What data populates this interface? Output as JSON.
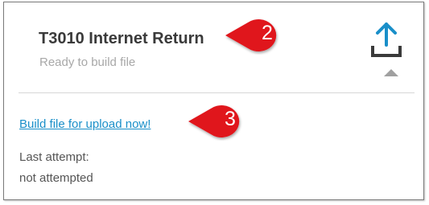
{
  "card": {
    "title": "T3010 Internet Return",
    "status": "Ready to build file",
    "upload_icon": "upload-icon",
    "collapse_icon": "chevron-up-icon",
    "build_link": "Build file for upload now!",
    "last_attempt_label": "Last attempt:",
    "last_attempt_value": "not attempted"
  },
  "callouts": [
    {
      "number": "2"
    },
    {
      "number": "3"
    }
  ],
  "colors": {
    "accent": "#1a8fc9",
    "callout": "#e0161d",
    "icon_dark": "#3a3a3a",
    "icon_muted": "#a0a0a0"
  }
}
